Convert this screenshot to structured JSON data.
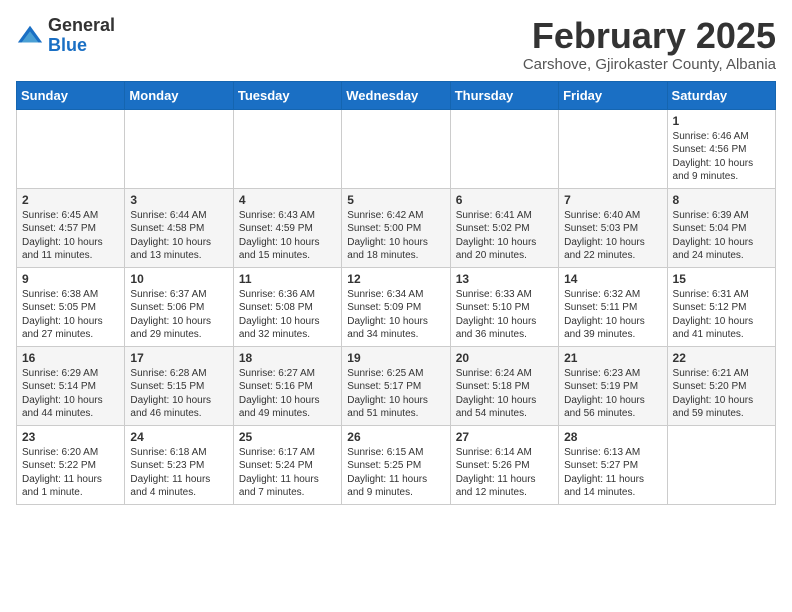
{
  "header": {
    "logo_general": "General",
    "logo_blue": "Blue",
    "month_title": "February 2025",
    "subtitle": "Carshove, Gjirokaster County, Albania"
  },
  "days_of_week": [
    "Sunday",
    "Monday",
    "Tuesday",
    "Wednesday",
    "Thursday",
    "Friday",
    "Saturday"
  ],
  "weeks": [
    [
      {
        "day": "",
        "info": ""
      },
      {
        "day": "",
        "info": ""
      },
      {
        "day": "",
        "info": ""
      },
      {
        "day": "",
        "info": ""
      },
      {
        "day": "",
        "info": ""
      },
      {
        "day": "",
        "info": ""
      },
      {
        "day": "1",
        "info": "Sunrise: 6:46 AM\nSunset: 4:56 PM\nDaylight: 10 hours\nand 9 minutes."
      }
    ],
    [
      {
        "day": "2",
        "info": "Sunrise: 6:45 AM\nSunset: 4:57 PM\nDaylight: 10 hours\nand 11 minutes."
      },
      {
        "day": "3",
        "info": "Sunrise: 6:44 AM\nSunset: 4:58 PM\nDaylight: 10 hours\nand 13 minutes."
      },
      {
        "day": "4",
        "info": "Sunrise: 6:43 AM\nSunset: 4:59 PM\nDaylight: 10 hours\nand 15 minutes."
      },
      {
        "day": "5",
        "info": "Sunrise: 6:42 AM\nSunset: 5:00 PM\nDaylight: 10 hours\nand 18 minutes."
      },
      {
        "day": "6",
        "info": "Sunrise: 6:41 AM\nSunset: 5:02 PM\nDaylight: 10 hours\nand 20 minutes."
      },
      {
        "day": "7",
        "info": "Sunrise: 6:40 AM\nSunset: 5:03 PM\nDaylight: 10 hours\nand 22 minutes."
      },
      {
        "day": "8",
        "info": "Sunrise: 6:39 AM\nSunset: 5:04 PM\nDaylight: 10 hours\nand 24 minutes."
      }
    ],
    [
      {
        "day": "9",
        "info": "Sunrise: 6:38 AM\nSunset: 5:05 PM\nDaylight: 10 hours\nand 27 minutes."
      },
      {
        "day": "10",
        "info": "Sunrise: 6:37 AM\nSunset: 5:06 PM\nDaylight: 10 hours\nand 29 minutes."
      },
      {
        "day": "11",
        "info": "Sunrise: 6:36 AM\nSunset: 5:08 PM\nDaylight: 10 hours\nand 32 minutes."
      },
      {
        "day": "12",
        "info": "Sunrise: 6:34 AM\nSunset: 5:09 PM\nDaylight: 10 hours\nand 34 minutes."
      },
      {
        "day": "13",
        "info": "Sunrise: 6:33 AM\nSunset: 5:10 PM\nDaylight: 10 hours\nand 36 minutes."
      },
      {
        "day": "14",
        "info": "Sunrise: 6:32 AM\nSunset: 5:11 PM\nDaylight: 10 hours\nand 39 minutes."
      },
      {
        "day": "15",
        "info": "Sunrise: 6:31 AM\nSunset: 5:12 PM\nDaylight: 10 hours\nand 41 minutes."
      }
    ],
    [
      {
        "day": "16",
        "info": "Sunrise: 6:29 AM\nSunset: 5:14 PM\nDaylight: 10 hours\nand 44 minutes."
      },
      {
        "day": "17",
        "info": "Sunrise: 6:28 AM\nSunset: 5:15 PM\nDaylight: 10 hours\nand 46 minutes."
      },
      {
        "day": "18",
        "info": "Sunrise: 6:27 AM\nSunset: 5:16 PM\nDaylight: 10 hours\nand 49 minutes."
      },
      {
        "day": "19",
        "info": "Sunrise: 6:25 AM\nSunset: 5:17 PM\nDaylight: 10 hours\nand 51 minutes."
      },
      {
        "day": "20",
        "info": "Sunrise: 6:24 AM\nSunset: 5:18 PM\nDaylight: 10 hours\nand 54 minutes."
      },
      {
        "day": "21",
        "info": "Sunrise: 6:23 AM\nSunset: 5:19 PM\nDaylight: 10 hours\nand 56 minutes."
      },
      {
        "day": "22",
        "info": "Sunrise: 6:21 AM\nSunset: 5:20 PM\nDaylight: 10 hours\nand 59 minutes."
      }
    ],
    [
      {
        "day": "23",
        "info": "Sunrise: 6:20 AM\nSunset: 5:22 PM\nDaylight: 11 hours\nand 1 minute."
      },
      {
        "day": "24",
        "info": "Sunrise: 6:18 AM\nSunset: 5:23 PM\nDaylight: 11 hours\nand 4 minutes."
      },
      {
        "day": "25",
        "info": "Sunrise: 6:17 AM\nSunset: 5:24 PM\nDaylight: 11 hours\nand 7 minutes."
      },
      {
        "day": "26",
        "info": "Sunrise: 6:15 AM\nSunset: 5:25 PM\nDaylight: 11 hours\nand 9 minutes."
      },
      {
        "day": "27",
        "info": "Sunrise: 6:14 AM\nSunset: 5:26 PM\nDaylight: 11 hours\nand 12 minutes."
      },
      {
        "day": "28",
        "info": "Sunrise: 6:13 AM\nSunset: 5:27 PM\nDaylight: 11 hours\nand 14 minutes."
      },
      {
        "day": "",
        "info": ""
      }
    ]
  ]
}
